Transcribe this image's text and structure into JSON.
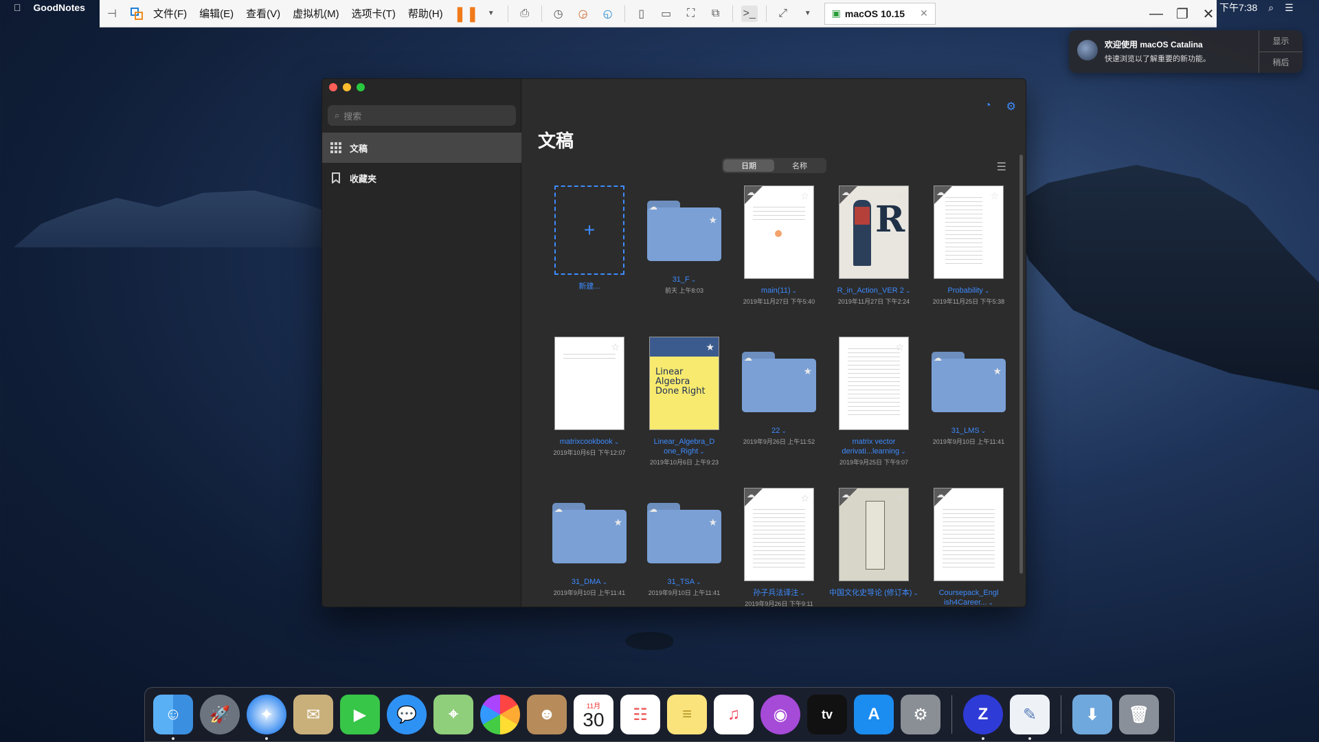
{
  "mac_menubar": {
    "app_name": "GoodNotes",
    "clock": "下午7:38"
  },
  "vmware": {
    "menus": [
      "文件(F)",
      "编辑(E)",
      "查看(V)",
      "虚拟机(M)",
      "选项卡(T)",
      "帮助(H)"
    ],
    "tab_label": "macOS 10.15"
  },
  "notification": {
    "title": "欢迎使用 macOS Catalina",
    "body": "快速浏览以了解重要的新功能。",
    "show_label": "显示",
    "later_label": "稍后"
  },
  "sidebar": {
    "search_placeholder": "搜索",
    "items": [
      {
        "label": "文稿",
        "icon": "grid-icon"
      },
      {
        "label": "收藏夹",
        "icon": "bookmark-icon"
      }
    ]
  },
  "main": {
    "title": "文稿",
    "sort": {
      "date_label": "日期",
      "name_label": "名称",
      "selected": "日期"
    },
    "items": [
      {
        "kind": "new",
        "name": "新建...",
        "date": ""
      },
      {
        "kind": "folder",
        "name": "31_F",
        "date": "前天 上午8:03"
      },
      {
        "kind": "doc",
        "name": "main(11)",
        "date": "2019年11月27日 下午5:40"
      },
      {
        "kind": "doc",
        "name": "R_in_Action_VER 2",
        "date": "2019年11月27日 下午2:24"
      },
      {
        "kind": "doc",
        "name": "Probability",
        "date": "2019年11月25日 下午5:38"
      },
      {
        "kind": "doc",
        "name": "matrixcookbook",
        "date": "2019年10月6日 下午12:07"
      },
      {
        "kind": "doc",
        "name": "Linear_Algebra_D one_Right",
        "date": "2019年10月6日 上午9:23"
      },
      {
        "kind": "folder",
        "name": "22",
        "date": "2019年9月26日 上午11:52"
      },
      {
        "kind": "doc",
        "name": "matrix vector derivati...learning",
        "date": "2019年9月25日 下午9:07"
      },
      {
        "kind": "folder",
        "name": "31_LMS",
        "date": "2019年9月10日 上午11:41"
      },
      {
        "kind": "folder",
        "name": "31_DMA",
        "date": "2019年9月10日 上午11:41"
      },
      {
        "kind": "folder",
        "name": "31_TSA",
        "date": "2019年9月10日 上午11:41"
      },
      {
        "kind": "doc",
        "name": "孙子兵法译注",
        "date": "2019年9月26日 下午9:11"
      },
      {
        "kind": "doc",
        "name": "中国文化史导论 (修订本)",
        "date": ""
      },
      {
        "kind": "doc",
        "name": "Coursepack_Engl ish4Career...",
        "date": ""
      }
    ]
  },
  "dock": {
    "apps": [
      "Finder",
      "Launchpad",
      "Safari",
      "Mail",
      "FaceTime",
      "Messages",
      "Maps",
      "Photos",
      "Contacts",
      "Calendar",
      "Reminders",
      "Notes",
      "Music",
      "Podcasts",
      "TV",
      "App Store",
      "System Preferences",
      "GoodNotes",
      "TextEdit",
      "Downloads",
      "Trash"
    ],
    "calendar_month": "11月",
    "calendar_day": "30",
    "tv_label": "tv"
  },
  "colors": {
    "accent": "#3d8bff",
    "folder": "#7aa0d6",
    "window_bg": "#2c2c2c",
    "sidebar_bg": "#262626"
  }
}
